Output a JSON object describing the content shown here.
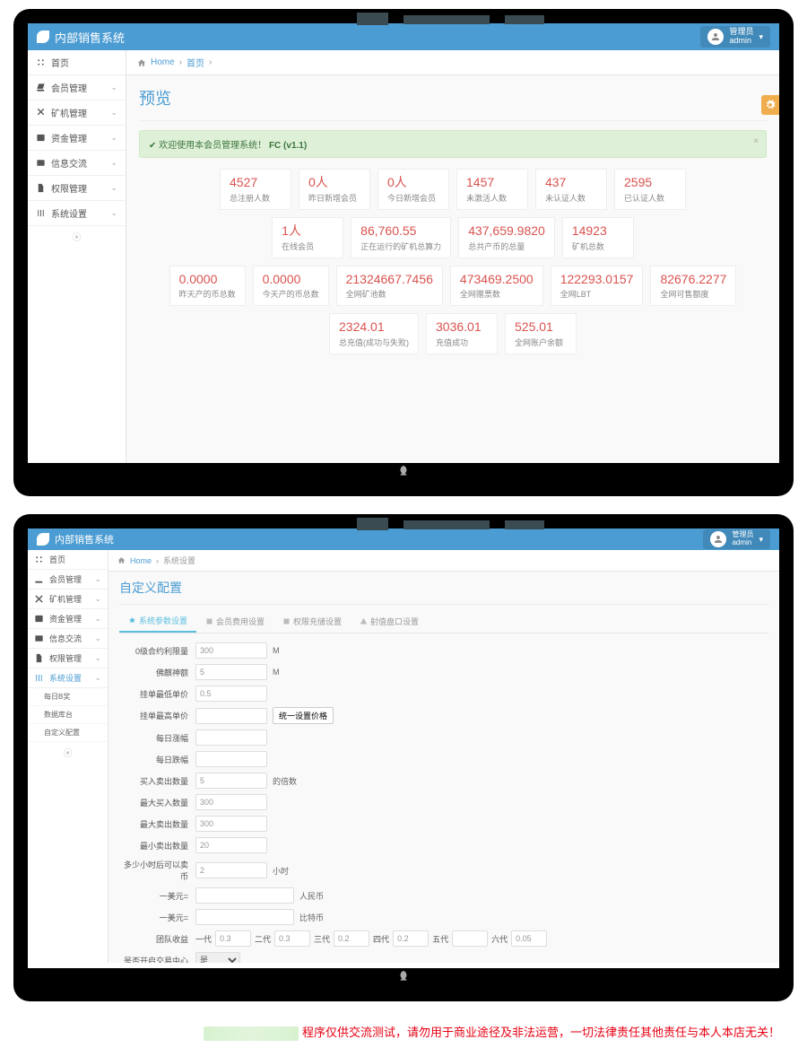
{
  "brand": "内部销售系统",
  "user": {
    "role": "管理员",
    "name": "admin"
  },
  "sidebar": {
    "items": [
      {
        "label": "首页",
        "expandable": false
      },
      {
        "label": "会员管理",
        "expandable": true
      },
      {
        "label": "矿机管理",
        "expandable": true
      },
      {
        "label": "资金管理",
        "expandable": true
      },
      {
        "label": "信息交流",
        "expandable": true
      },
      {
        "label": "权限管理",
        "expandable": true
      },
      {
        "label": "系统设置",
        "expandable": true
      }
    ],
    "sub_settings": [
      "每日B奖",
      "数据库台",
      "自定义配置"
    ]
  },
  "screen1": {
    "breadcrumb": {
      "home": "Home",
      "page": "首页"
    },
    "title": "预览",
    "alert_prefix": "欢迎使用本会员管理系统！",
    "alert_suffix": "FC (v1.1)",
    "stats": {
      "row1": [
        {
          "val": "4527",
          "lbl": "总注册人数"
        },
        {
          "val": "0人",
          "lbl": "昨日新增会员"
        },
        {
          "val": "0人",
          "lbl": "今日新增会员"
        },
        {
          "val": "1457",
          "lbl": "未激活人数"
        },
        {
          "val": "437",
          "lbl": "未认证人数"
        },
        {
          "val": "2595",
          "lbl": "已认证人数"
        }
      ],
      "row2": [
        {
          "val": "1人",
          "lbl": "在线会员"
        },
        {
          "val": "86,760.55",
          "lbl": "正在运行的矿机总算力"
        },
        {
          "val": "437,659.9820",
          "lbl": "总共产币的总量"
        },
        {
          "val": "14923",
          "lbl": "矿机总数"
        }
      ],
      "row3": [
        {
          "val": "0.0000",
          "lbl": "昨天产的币总数"
        },
        {
          "val": "0.0000",
          "lbl": "今天产的币总数"
        },
        {
          "val": "21324667.7456",
          "lbl": "全网矿池数"
        },
        {
          "val": "473469.2500",
          "lbl": "全网赠票数"
        },
        {
          "val": "122293.0157",
          "lbl": "全网LBT"
        },
        {
          "val": "82676.2277",
          "lbl": "全网可售额度"
        }
      ],
      "row4": [
        {
          "val": "2324.01",
          "lbl": "总充值(成功与失败)"
        },
        {
          "val": "3036.01",
          "lbl": "充值成功"
        },
        {
          "val": "525.01",
          "lbl": "全网账户余额"
        }
      ]
    }
  },
  "screen2": {
    "breadcrumb": {
      "home": "Home",
      "page": "系统设置"
    },
    "title": "自定义配置",
    "tabs": [
      "系统参数设置",
      "会员费用设置",
      "权限充储设置",
      "射值盘口设置"
    ],
    "form": {
      "r0": {
        "label": "0级合约利限量",
        "value": "300",
        "unit": "M"
      },
      "r1": {
        "label": "佛麒神额",
        "value": "5",
        "unit": "M"
      },
      "r2": {
        "label": "挂单最低单价",
        "value": "0.5"
      },
      "r3": {
        "label": "挂单最高单价",
        "value": "",
        "btn": "统一设置价格"
      },
      "r4": {
        "label": "每日涨幅",
        "value": ""
      },
      "r5": {
        "label": "每日跌幅",
        "value": ""
      },
      "r6": {
        "label": "买入卖出数量",
        "value": "5",
        "unit": "的倍数"
      },
      "r7": {
        "label": "最大买入数量",
        "value": "300"
      },
      "r8": {
        "label": "最大卖出数量",
        "value": "300"
      },
      "r9": {
        "label": "最小卖出数量",
        "value": "20"
      },
      "r10": {
        "label": "多少小时后可以卖币",
        "value": "2",
        "unit": "小时"
      },
      "r11": {
        "label": "一美元=",
        "value": "",
        "unit": "人民币"
      },
      "r12": {
        "label": "一美元=",
        "value": "",
        "unit": "比特币"
      },
      "r13": {
        "label": "团队收益",
        "pairs": [
          {
            "l": "一代",
            "v": "0.3"
          },
          {
            "l": "二代",
            "v": "0.3"
          },
          {
            "l": "三代",
            "v": "0.2"
          },
          {
            "l": "四代",
            "v": "0.2"
          },
          {
            "l": "五代",
            "v": ""
          },
          {
            "l": "六代",
            "v": "0.05"
          }
        ]
      },
      "r14": {
        "label": "是否开启交易中心",
        "value": "是"
      }
    }
  },
  "footer": "程序仅供交流测试，请勿用于商业途径及非法运营，一切法律责任其他责任与本人本店无关！"
}
